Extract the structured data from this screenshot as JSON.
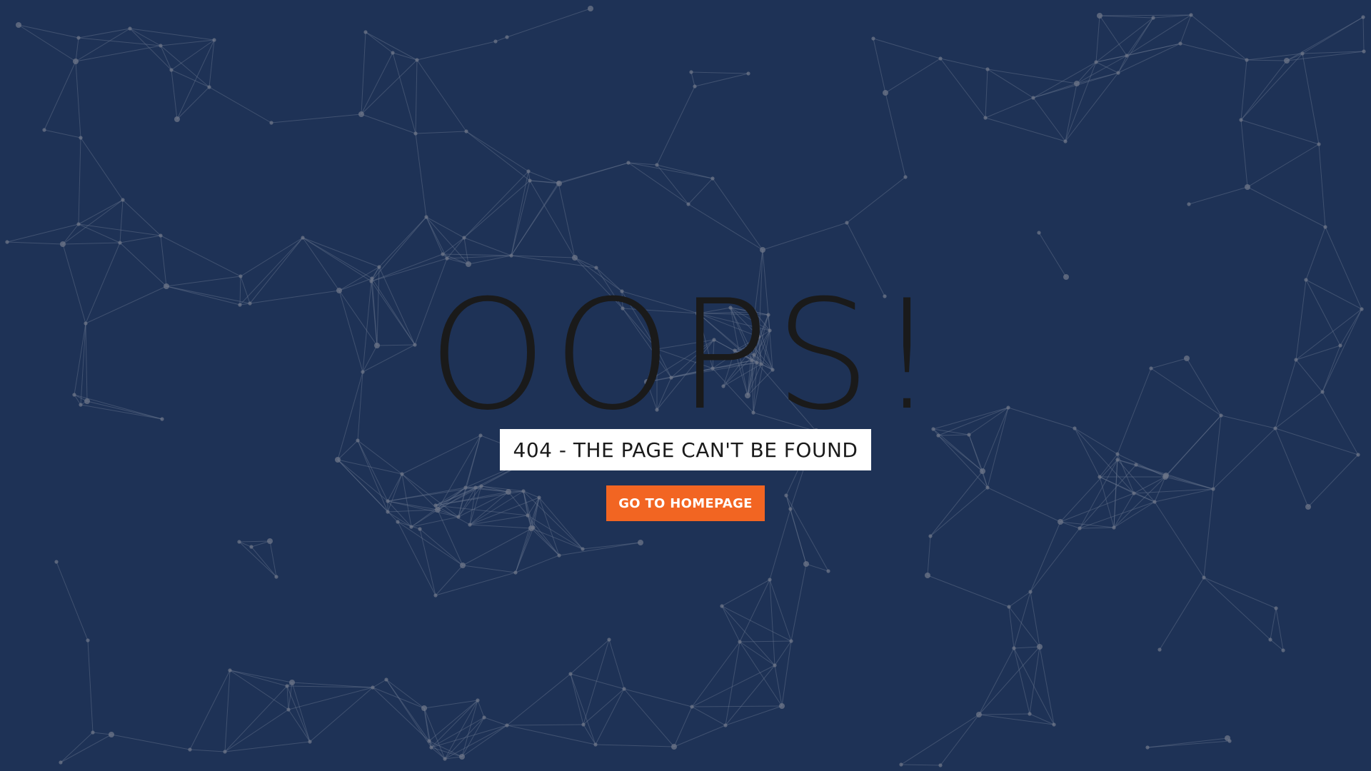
{
  "error": {
    "headline": "OOPS!",
    "message": "404 - THE PAGE CAN'T BE FOUND"
  },
  "actions": {
    "home_label": "GO TO HOMEPAGE"
  },
  "colors": {
    "background": "#1e3256",
    "button": "#f26522",
    "network_lines": "#6b7891"
  }
}
